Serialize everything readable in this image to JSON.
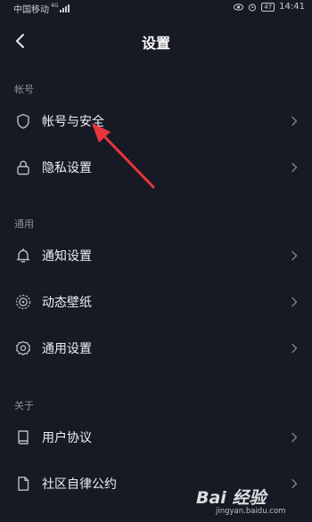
{
  "status_bar": {
    "carrier": "中国移动",
    "network_badge": "4G",
    "battery": "47",
    "time": "14:41"
  },
  "header": {
    "title": "设置"
  },
  "sections": {
    "account": "帐号",
    "general": "通用",
    "about": "关于"
  },
  "items": [
    {
      "label": "帐号与安全",
      "icon": "shield-icon"
    },
    {
      "label": "隐私设置",
      "icon": "lock-icon"
    },
    {
      "label": "通知设置",
      "icon": "bell-icon"
    },
    {
      "label": "动态壁纸",
      "icon": "wallpaper-icon"
    },
    {
      "label": "通用设置",
      "icon": "gear-icon"
    },
    {
      "label": "用户协议",
      "icon": "book-icon"
    },
    {
      "label": "社区自律公约",
      "icon": "document-icon"
    }
  ],
  "watermark": {
    "logo": "Bai 经验",
    "url": "jingyan.baidu.com"
  },
  "colors": {
    "background": "#171a25",
    "annotation_arrow": "#e8353b"
  }
}
